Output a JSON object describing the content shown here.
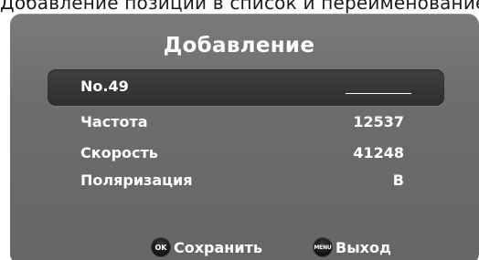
{
  "background": {
    "text": "Добавление позиций в список и переименование"
  },
  "dialog": {
    "title": "Добавление",
    "selected_item": {
      "label": "No.49",
      "input_value": ""
    },
    "rows": [
      {
        "label": "Частота",
        "value": "12537"
      },
      {
        "label": "Скорость",
        "value": "41248"
      },
      {
        "label": "Поляризация",
        "value": "В"
      }
    ],
    "footer": {
      "save": {
        "icon_text": "OK",
        "icon": "ok-remote-key-icon",
        "label": "Сохранить"
      },
      "exit": {
        "icon_text": "MENU",
        "icon": "menu-remote-key-icon",
        "label": "Выход"
      }
    }
  },
  "colors": {
    "dialog_bg": "#6d6d6d",
    "selected_row_bg": "#333333",
    "text": "#ffffff"
  }
}
